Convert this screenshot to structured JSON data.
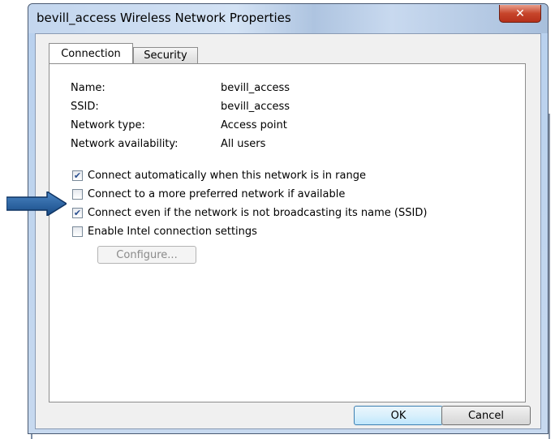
{
  "window": {
    "title": "bevill_access Wireless Network Properties",
    "close_glyph": "✕"
  },
  "tabs": [
    {
      "label": "Connection",
      "selected": true
    },
    {
      "label": "Security",
      "selected": false
    }
  ],
  "info": [
    {
      "label": "Name:",
      "value": "bevill_access"
    },
    {
      "label": "SSID:",
      "value": "bevill_access"
    },
    {
      "label": "Network type:",
      "value": "Access point"
    },
    {
      "label": "Network availability:",
      "value": "All users"
    }
  ],
  "checkboxes": [
    {
      "label": "Connect automatically when this network is in range",
      "checked": true
    },
    {
      "label": "Connect to a more preferred network if available",
      "checked": false
    },
    {
      "label": "Connect even if the network is not broadcasting its name (SSID)",
      "checked": true
    },
    {
      "label": "Enable Intel connection settings",
      "checked": false
    }
  ],
  "configure_label": "Configure...",
  "buttons": {
    "ok": "OK",
    "cancel": "Cancel"
  },
  "colors": {
    "arrow": "#1f5d9e",
    "accent": "#3c7fb1",
    "close": "#c7452b"
  },
  "annotation": {
    "icon": "arrow-right-icon"
  }
}
